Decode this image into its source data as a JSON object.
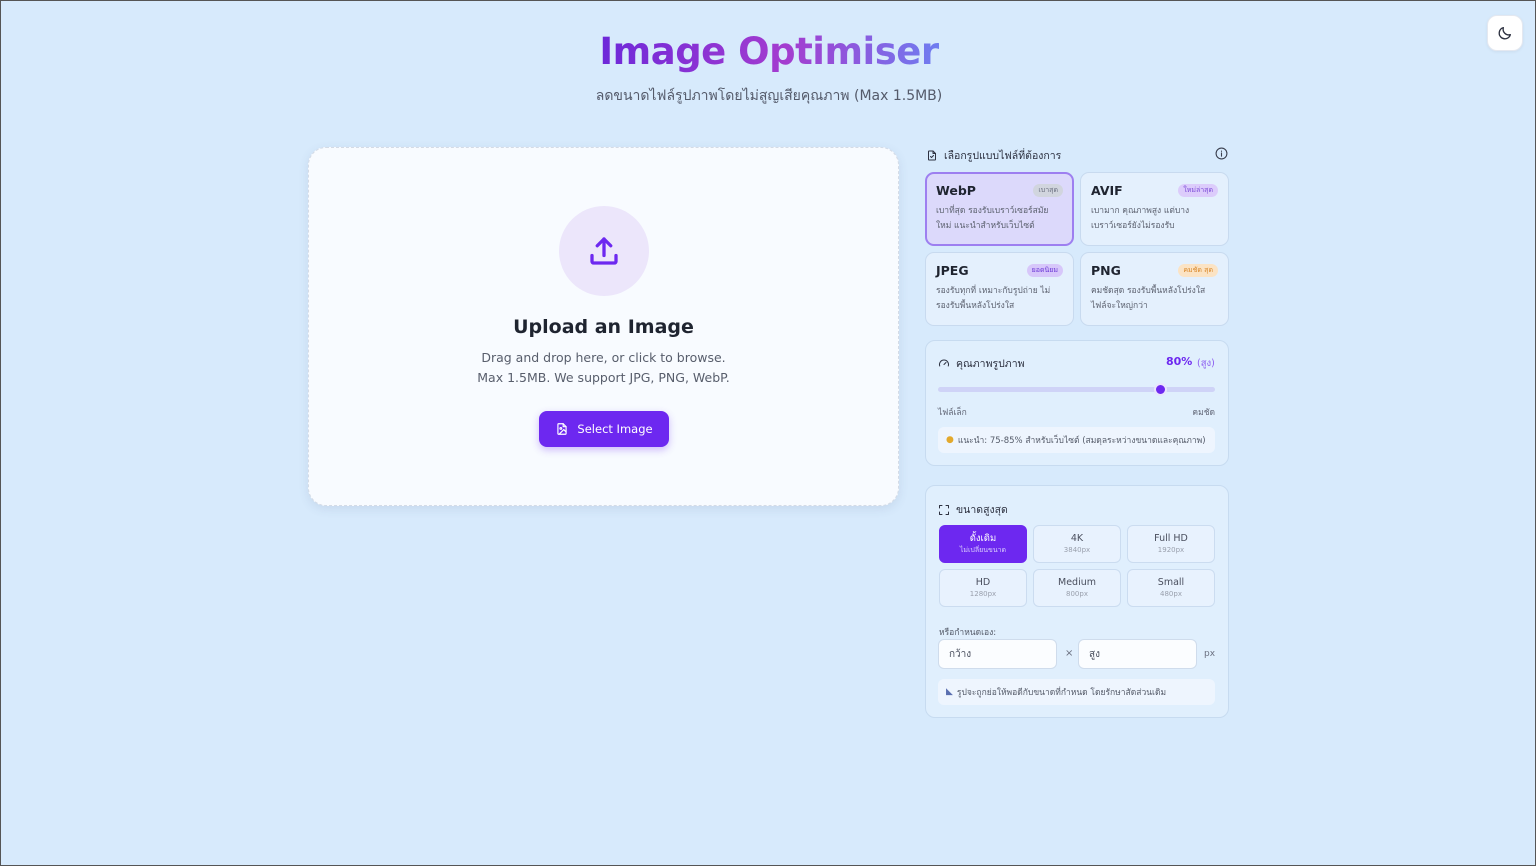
{
  "header": {
    "title": "Image Optimiser",
    "subtitle": "ลดขนาดไฟล์รูปภาพโดยไม่สูญเสียคุณภาพ (Max 1.5MB)"
  },
  "theme_toggle": {
    "icon": "moon-icon"
  },
  "upload": {
    "icon": "upload-icon",
    "title": "Upload an Image",
    "desc_line1": "Drag and drop here, or click to browse.",
    "desc_line2": "Max 1.5MB. We support JPG, PNG, WebP.",
    "button_label": "Select Image"
  },
  "format": {
    "section_label": "เลือกรูปแบบไฟล์ที่ต้องการ",
    "selected": "WebP",
    "options": [
      {
        "name": "WebP",
        "badge": "เบาสุด",
        "desc1": "เบาที่สุด รองรับเบราว์เซอร์สมัย",
        "desc2": "ใหม่ แนะนำสำหรับเว็บไซต์"
      },
      {
        "name": "AVIF",
        "badge": "ใหม่ล่าสุด",
        "desc1": "เบามาก คุณภาพสูง แต่บาง",
        "desc2": "เบราว์เซอร์ยังไม่รองรับ"
      },
      {
        "name": "JPEG",
        "badge": "ยอดนิยม",
        "desc1": "รองรับทุกที่ เหมาะกับรูปถ่าย ไม่",
        "desc2": "รองรับพื้นหลังโปร่งใส"
      },
      {
        "name": "PNG",
        "badge": "คมชัด สุด",
        "desc1": "คมชัดสุด รองรับพื้นหลังโปร่งใส",
        "desc2": "ไฟล์จะใหญ่กว่า"
      }
    ]
  },
  "quality": {
    "label": "คุณภาพรูปภาพ",
    "value_text": "80%",
    "level_text": "(สูง)",
    "value_percent": 80,
    "min_label": "ไฟล์เล็ก",
    "max_label": "คมชัด",
    "tip": "แนะนำ: 75-85% สำหรับเว็บไซต์ (สมดุลระหว่างขนาดและคุณภาพ)"
  },
  "max_size": {
    "label": "ขนาดสูงสุด",
    "options": [
      {
        "name": "ดั้งเดิม",
        "sub": "ไม่เปลี่ยนขนาด",
        "active": true
      },
      {
        "name": "4K",
        "sub": "3840px"
      },
      {
        "name": "Full HD",
        "sub": "1920px"
      },
      {
        "name": "HD",
        "sub": "1280px"
      },
      {
        "name": "Medium",
        "sub": "800px"
      },
      {
        "name": "Small",
        "sub": "480px"
      }
    ],
    "custom_label": "หรือกำหนดเอง:",
    "width_placeholder": "กว้าง",
    "height_placeholder": "สูง",
    "times": "×",
    "unit": "px",
    "note": "รูปจะถูกย่อให้พอดีกับขนาดที่กำหนด โดยรักษาสัดส่วนเดิม"
  },
  "colors": {
    "accent": "#6d28f0",
    "background": "#d7eafc"
  }
}
